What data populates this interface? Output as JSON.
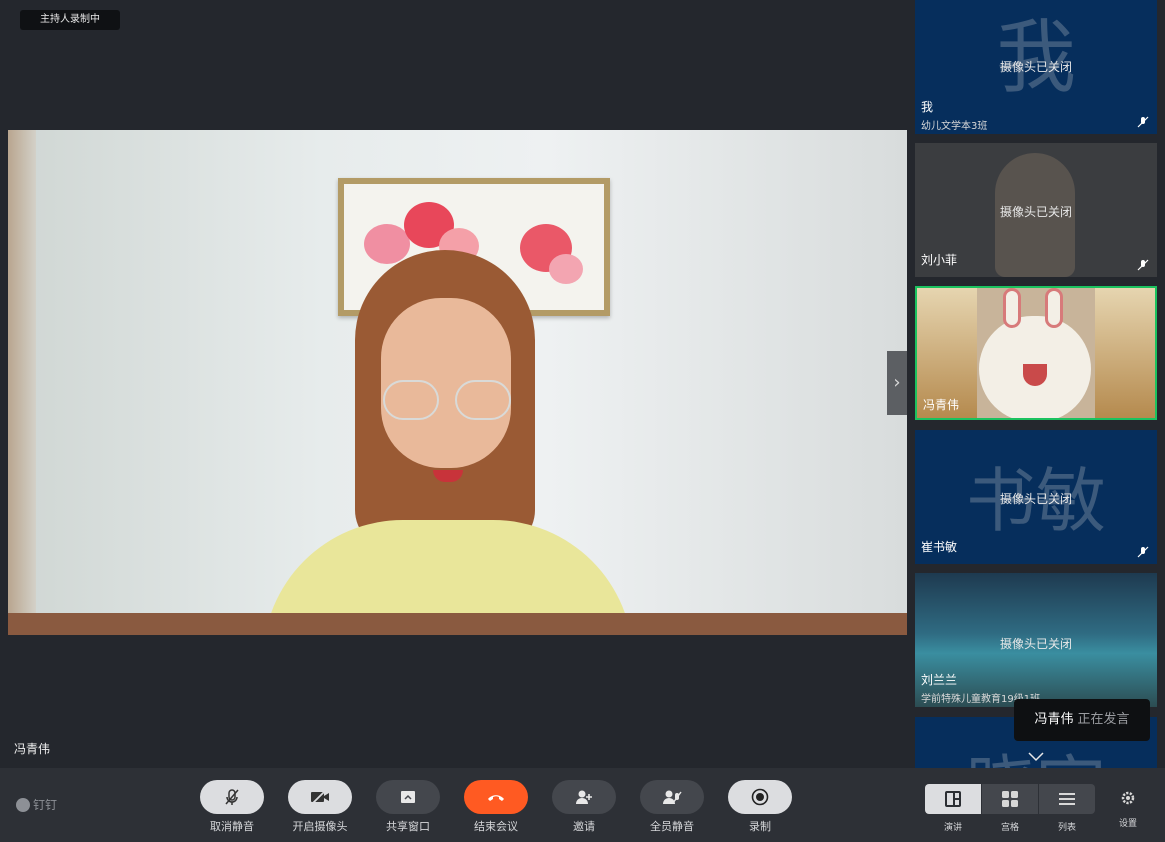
{
  "recording_badge": "主持人录制中",
  "main_speaker_name": "冯青伟",
  "speaking_toast": {
    "name": "冯青伟",
    "state": "正在发言"
  },
  "brand": "钉钉",
  "tiles": [
    {
      "avatar_char": "我",
      "cam_off": "摄像头已关闭",
      "name": "我",
      "subtitle": "幼儿文学本3班",
      "bg": "#062e5c"
    },
    {
      "avatar_char": "",
      "cam_off": "摄像头已关闭",
      "name": "刘小菲",
      "subtitle": "",
      "bg": "#3b3d40"
    },
    {
      "avatar_char": "",
      "cam_off": "",
      "name": "冯青伟",
      "subtitle": "",
      "bg": "#8c7a5c",
      "active_border": "#1bc25f"
    },
    {
      "avatar_char": "书敏",
      "cam_off": "摄像头已关闭",
      "name": "崔书敏",
      "subtitle": "",
      "bg": "#062e5c"
    },
    {
      "avatar_char": "",
      "cam_off": "摄像头已关闭",
      "name": "刘兰兰",
      "subtitle": "学前特殊儿童教育19级1班",
      "bg": "#2c4d5e"
    },
    {
      "avatar_char": "晓宇",
      "cam_off": "",
      "name": "",
      "subtitle": "",
      "bg": "#062e5c"
    }
  ],
  "controls": [
    {
      "label": "取消静音",
      "icon": "mic-muted-icon"
    },
    {
      "label": "开启摄像头",
      "icon": "camera-off-icon"
    },
    {
      "label": "共享窗口",
      "icon": "share-screen-icon"
    },
    {
      "label": "结束会议",
      "icon": "hangup-icon"
    },
    {
      "label": "邀请",
      "icon": "add-user-icon"
    },
    {
      "label": "全员静音",
      "icon": "mute-all-icon"
    },
    {
      "label": "录制",
      "icon": "record-icon"
    }
  ],
  "views": [
    {
      "label": "演讲",
      "icon": "speaker-view-icon"
    },
    {
      "label": "宫格",
      "icon": "grid-view-icon"
    },
    {
      "label": "列表",
      "icon": "list-view-icon"
    }
  ],
  "settings_label": "设置",
  "colors": {
    "end_call": "#ff5a22",
    "active_speaker": "#1bc25f",
    "tile_blue": "#062e5c"
  }
}
